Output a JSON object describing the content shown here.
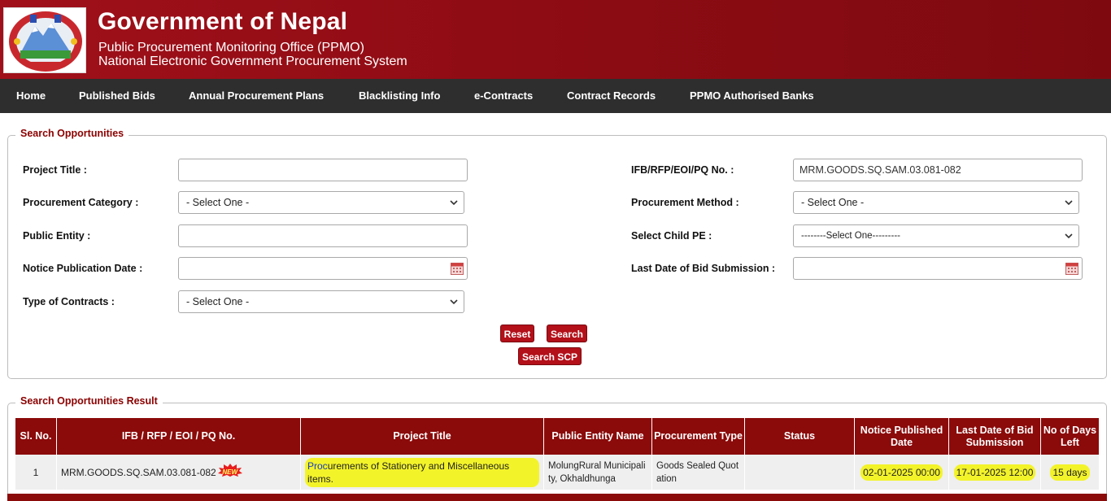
{
  "header": {
    "title": "Government of Nepal",
    "subtitle1": "Public Procurement Monitoring Office (PPMO)",
    "subtitle2": "National Electronic Government Procurement System"
  },
  "nav": {
    "items": [
      "Home",
      "Published Bids",
      "Annual Procurement Plans",
      "Blacklisting Info",
      "e-Contracts",
      "Contract Records",
      "PPMO Authorised Banks"
    ]
  },
  "search": {
    "legend": "Search Opportunities",
    "project_title_label": "Project Title :",
    "project_title_value": "",
    "procurement_category_label": "Procurement Category :",
    "procurement_category_value": "- Select One -",
    "public_entity_label": "Public Entity :",
    "public_entity_value": "",
    "notice_date_label": "Notice Publication Date :",
    "notice_date_value": "",
    "contract_type_label": "Type of Contracts :",
    "contract_type_value": "- Select One -",
    "ifb_label": "IFB/RFP/EOI/PQ No. :",
    "ifb_value": "MRM.GOODS.SQ.SAM.03.081-082",
    "method_label": "Procurement Method :",
    "method_value": "- Select One -",
    "child_pe_label": "Select Child PE :",
    "child_pe_value": "--------Select One---------",
    "last_date_label": "Last Date of Bid Submission :",
    "last_date_value": "",
    "reset_label": "Reset",
    "search_label": "Search",
    "search_scp_label": "Search SCP"
  },
  "results": {
    "legend": "Search Opportunities Result",
    "columns": [
      "Sl. No.",
      "IFB / RFP / EOI / PQ No.",
      "Project Title",
      "Public Entity Name",
      "Procurement Type",
      "Status",
      "Notice Published Date",
      "Last Date of Bid Submission",
      "No of Days Left"
    ],
    "rows": [
      {
        "sl": "1",
        "ifb": "MRM.GOODS.SQ.SAM.03.081-082",
        "new_badge": "NEW",
        "title_link": "Proc",
        "title_rest": "urements of Stationery and Miscellaneous items.",
        "entity": "MolungRural Municipality, Okhaldhunga",
        "type": "Goods  Sealed Quotation",
        "status": "",
        "notice_date": "02-01-2025 00:00",
        "last_date": "17-01-2025 12:00",
        "days_left": "15 days"
      }
    ]
  },
  "colors": {
    "header_bg": "#9a0e17",
    "nav_bg": "#2e2e2e",
    "accent": "#8b0a0a",
    "button": "#b3101a",
    "highlight": "#f3f32a"
  }
}
